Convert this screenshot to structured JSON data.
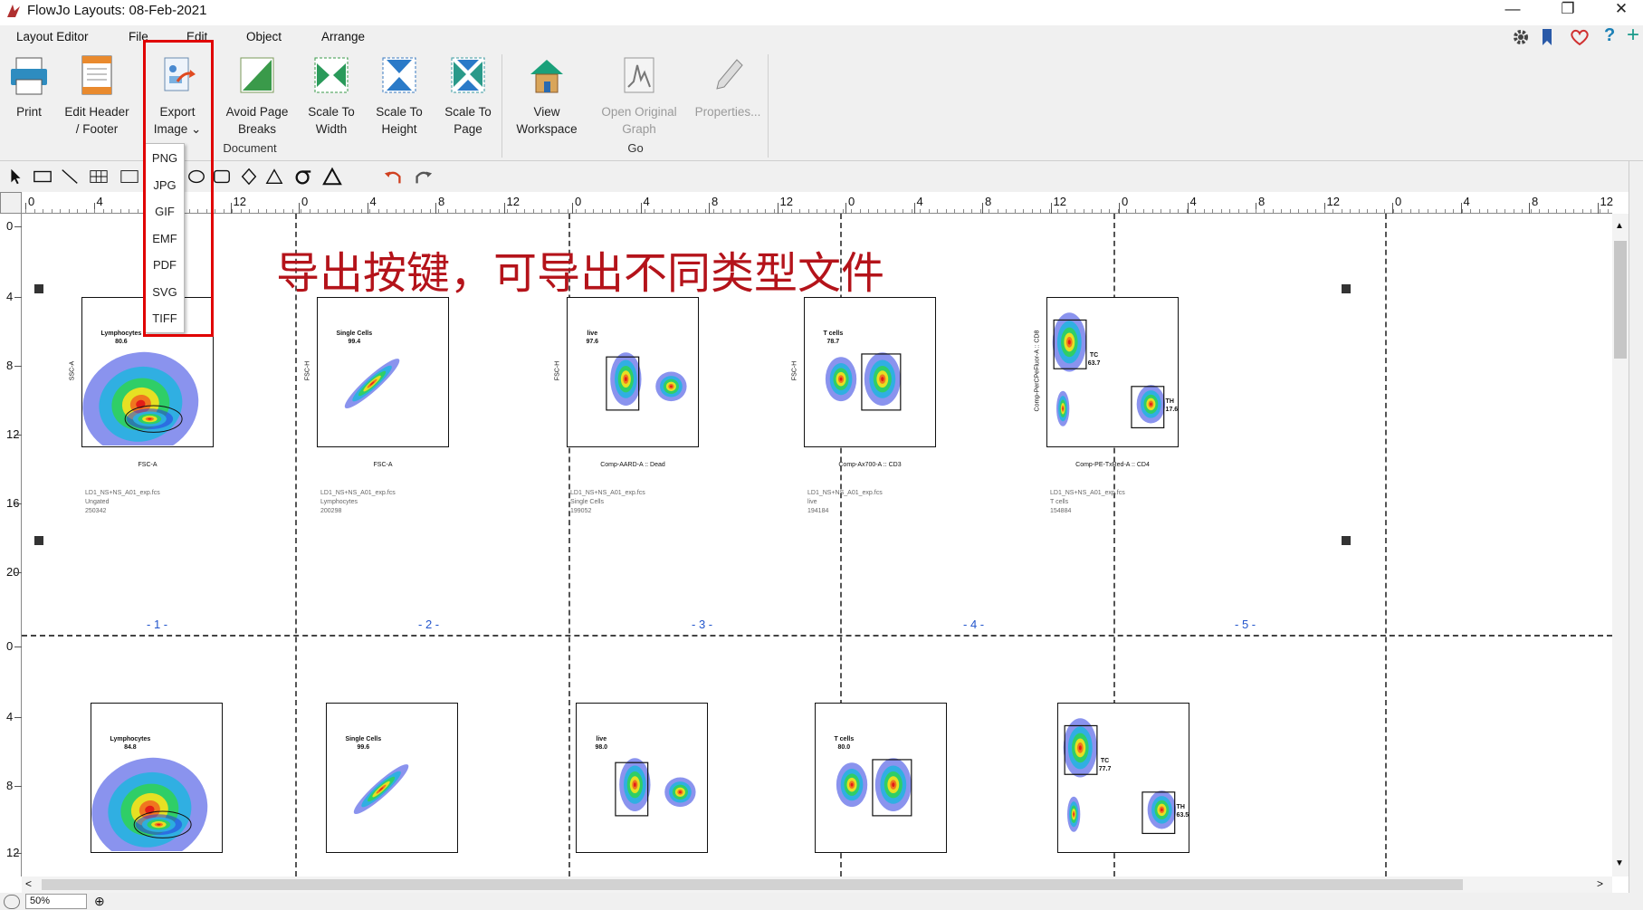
{
  "window": {
    "title": "FlowJo Layouts: 08-Feb-2021",
    "minimize": "—",
    "restore": "❐",
    "close": "✕"
  },
  "menu": [
    "Layout Editor",
    "File",
    "Edit",
    "Object",
    "Arrange"
  ],
  "ribbon": {
    "print": [
      "Print",
      ""
    ],
    "edit_header": [
      "Edit Header",
      "/ Footer"
    ],
    "export": [
      "Export",
      "Image ⌄"
    ],
    "avoid_page_breaks": [
      "Avoid Page",
      "Breaks"
    ],
    "scale_width": [
      "Scale To",
      "Width"
    ],
    "scale_height": [
      "Scale To",
      "Height"
    ],
    "scale_page": [
      "Scale To",
      "Page"
    ],
    "view_workspace": [
      "View",
      "Workspace"
    ],
    "open_original": [
      "Open Original",
      "Graph"
    ],
    "properties": [
      "Properties...",
      ""
    ],
    "groups": {
      "document": "Document",
      "go": "Go"
    }
  },
  "export_menu": [
    "PNG",
    "JPG",
    "GIF",
    "EMF",
    "PDF",
    "SVG",
    "TIFF"
  ],
  "annotation": "导出按键，可导出不同类型文件",
  "hruler_ticks": [
    "0",
    "4",
    "8",
    "12",
    "0",
    "4",
    "8",
    "12",
    "0",
    "4",
    "8",
    "12",
    "0",
    "4",
    "8",
    "12",
    "0",
    "4",
    "8",
    "12",
    "0",
    "4",
    "8",
    "12"
  ],
  "vruler_ticks": [
    "0",
    "4",
    "8",
    "12",
    "16",
    "20",
    "0",
    "4",
    "8",
    "12"
  ],
  "page_numbers": [
    "- 1 -",
    "- 2 -",
    "- 3 -",
    "- 4 -",
    "- 5 -"
  ],
  "plots_row1": [
    {
      "gate": "Lymphocytes",
      "pct": "80.6",
      "xlabel": "FSC-A",
      "ylabel": "SSC-A",
      "cap": [
        "LD1_NS+NS_A01_exp.fcs",
        "Ungated",
        "250342"
      ]
    },
    {
      "gate": "Single Cells",
      "pct": "99.4",
      "xlabel": "FSC-A",
      "ylabel": "FSC-H",
      "cap": [
        "LD1_NS+NS_A01_exp.fcs",
        "Lymphocytes",
        "200298"
      ]
    },
    {
      "gate": "live",
      "pct": "97.6",
      "xlabel": "Comp-AARD-A :: Dead",
      "ylabel": "FSC-H",
      "cap": [
        "LD1_NS+NS_A01_exp.fcs",
        "Single Cells",
        "199052"
      ]
    },
    {
      "gate": "T cells",
      "pct": "78.7",
      "xlabel": "Comp-Ax700-A :: CD3",
      "ylabel": "FSC-H",
      "cap": [
        "LD1_NS+NS_A01_exp.fcs",
        "live",
        "194184"
      ]
    },
    {
      "gate": "TC",
      "pct": "63.7",
      "gate2": "TH",
      "pct2": "17.6",
      "xlabel": "Comp-PE-TxRed-A :: CD4",
      "ylabel": "Comp-PerCPeFluor-A :: CD8",
      "cap": [
        "LD1_NS+NS_A01_exp.fcs",
        "T cells",
        "154884"
      ]
    }
  ],
  "plots_row2": [
    {
      "gate": "Lymphocytes",
      "pct": "84.8"
    },
    {
      "gate": "Single Cells",
      "pct": "99.6"
    },
    {
      "gate": "live",
      "pct": "98.0"
    },
    {
      "gate": "T cells",
      "pct": "80.0"
    },
    {
      "gate": "TC",
      "pct": "77.7",
      "gate2": "TH",
      "pct2": "63.5"
    }
  ],
  "status": {
    "zoom": "50%"
  }
}
